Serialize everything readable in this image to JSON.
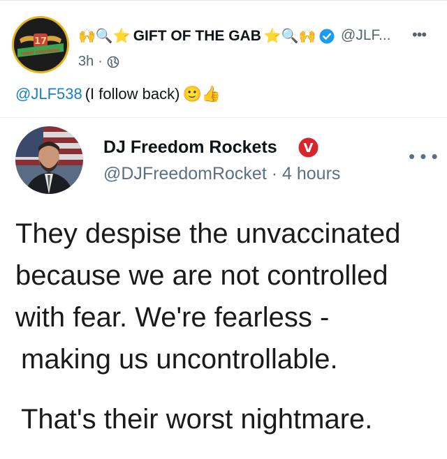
{
  "post": {
    "display_name": "GIFT OF THE GAB",
    "name_prefix_glyphs": "🙌🔍⭐",
    "name_suffix_glyphs": "⭐🔍🙌",
    "handle": "@JLF...",
    "time": "3h",
    "reply_mention": "@JLF538",
    "reply_text": "(I follow back)",
    "reply_emojis": "🙂👍",
    "avatar_text": "GREAT AWAKENING",
    "colors": {
      "verified": "#1d9bf0",
      "mention": "#1a7fbf",
      "muted": "#53646f"
    }
  },
  "quote": {
    "display_name": "DJ Freedom Rockets",
    "badge_letter": "V",
    "handle": "@DJFreedomRocket",
    "time": "· 4 hours",
    "more_label": "• • •",
    "text_lines": [
      "They despise the unvaccinated",
      "because we are not controlled",
      "with fear. We're fearless -",
      "making us uncontrollable.",
      "That's their worst nightmare."
    ],
    "colors": {
      "badge": "#d8242b",
      "muted": "#5b7083"
    }
  }
}
